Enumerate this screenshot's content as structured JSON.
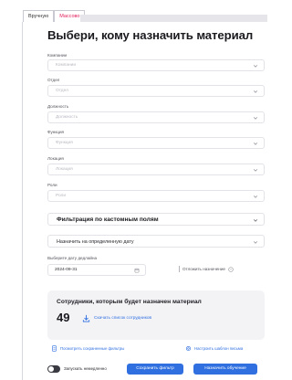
{
  "tabs": [
    {
      "label": "Вручную"
    },
    {
      "label": "Массово"
    }
  ],
  "title": "Выбери, кому назначить материал",
  "fields": [
    {
      "label": "Компании",
      "placeholder": "Компании"
    },
    {
      "label": "Отдел",
      "placeholder": "Отдел"
    },
    {
      "label": "Должность",
      "placeholder": "Должность"
    },
    {
      "label": "Функция",
      "placeholder": "Функция"
    },
    {
      "label": "Локация",
      "placeholder": "Локация"
    },
    {
      "label": "Роли",
      "placeholder": "Роли"
    }
  ],
  "custom_filter": {
    "label": "Фильтрация по кастомным полям"
  },
  "assign_mode": {
    "value": "Назначить на определенную дату"
  },
  "deadline": {
    "label": "Выберите дату дедлайна",
    "value": "2024-09-31",
    "toggle_label": "Отложить назначение"
  },
  "employees": {
    "title": "Сотрудники, которым будет назначен материал",
    "count": "49",
    "download_label": "Скачать список сотрудников"
  },
  "links": {
    "saved_filters": "Посмотреть сохраненные фильтры",
    "template": "Настроить шаблон письма"
  },
  "footer": {
    "immediate_label": "Запускать немедленно",
    "save_filter": "Сохранить фильтр",
    "assign": "Назначить обучение"
  },
  "colors": {
    "accent": "#2f6fe0",
    "active_tab": "#e01e5a"
  }
}
